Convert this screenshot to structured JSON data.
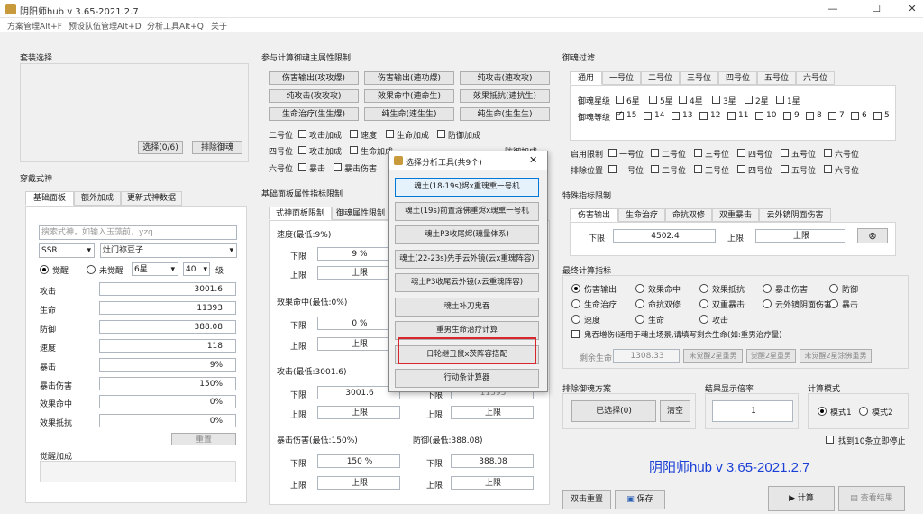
{
  "window": {
    "title": "阴阳师hub v 3.65-2021.2.7",
    "minimize": "—",
    "maximize": "☐",
    "close": "✕"
  },
  "menu": [
    "方案管理Alt+F",
    "预设队伍管理Alt+D",
    "分析工具Alt+Q",
    "关于"
  ],
  "set_select": {
    "title": "套装选择",
    "select_btn": "选择(0/6)",
    "exclude_btn": "排除御魂"
  },
  "equip": {
    "title": "穿戴式神",
    "tabs": [
      "基础面板",
      "额外加成",
      "更新式神数据"
    ],
    "search_placeholder": "搜索式神，如输入玉藻前，yzq…",
    "rarity": "SSR",
    "shikigami": "灶门祢豆子",
    "awake": "觉醒",
    "unawake": "未觉醒",
    "star": "6星",
    "level": "40",
    "level_unit": "级",
    "stats": [
      {
        "label": "攻击",
        "value": "3001.6"
      },
      {
        "label": "生命",
        "value": "11393"
      },
      {
        "label": "防御",
        "value": "388.08"
      },
      {
        "label": "速度",
        "value": "118"
      },
      {
        "label": "暴击",
        "value": "9%"
      },
      {
        "label": "暴击伤害",
        "value": "150%"
      },
      {
        "label": "效果命中",
        "value": "0%"
      },
      {
        "label": "效果抵抗",
        "value": "0%"
      }
    ],
    "reset": "重置",
    "awaken_bonus": "觉醒加成"
  },
  "attr_limit": {
    "title": "参与计算御魂主属性限制",
    "buttons": [
      [
        "伤害输出(攻攻爆)",
        "伤害输出(速功爆)",
        "纯攻击(速攻攻)"
      ],
      [
        "纯攻击(攻攻攻)",
        "效果命中(速命生)",
        "效果抵抗(速抗生)"
      ],
      [
        "生命治疗(生生爆)",
        "纯生命(速生生)",
        "纯生命(生生生)"
      ]
    ],
    "rows": [
      {
        "pos": "二号位",
        "opts": [
          "攻击加成",
          "速度",
          "生命加成",
          "防御加成"
        ]
      },
      {
        "pos": "四号位",
        "opts": [
          "攻击加成",
          "生命加成",
          "效果命中",
          "效果抵抗",
          "防御加成"
        ]
      },
      {
        "pos": "六号位",
        "opts": [
          "暴击",
          "暴击伤害"
        ]
      }
    ]
  },
  "base_limit": {
    "title": "基础面板属性指标限制",
    "tabs": [
      "式神面板限制",
      "御魂属性限制"
    ],
    "items": [
      {
        "title": "速度(最低:9%)",
        "min": "9 %",
        "max": "上限"
      },
      {
        "title": "效果命中(最低:0%)",
        "min": "0 %",
        "max": "上限"
      },
      {
        "title": "攻击(最低:3001.6)",
        "min": "3001.6",
        "max": "上限"
      },
      {
        "title": "暴击伤害(最低:150%)",
        "min": "150 %",
        "max": "上限"
      }
    ],
    "right_items": [
      {
        "title": "",
        "min": "11393",
        "max": "上限"
      },
      {
        "title": "防御(最低:388.08)",
        "min": "388.08",
        "max": "上限"
      }
    ],
    "min_label": "下限",
    "max_label": "上限"
  },
  "filter": {
    "title": "御魂过滤",
    "tabs": [
      "通用",
      "一号位",
      "二号位",
      "三号位",
      "四号位",
      "五号位",
      "六号位"
    ],
    "star_label": "御魂星级",
    "stars": [
      "6星",
      "5星",
      "4星",
      "3星",
      "2星",
      "1星"
    ],
    "level_label": "御魂等级",
    "levels": [
      "15",
      "14",
      "13",
      "12",
      "11",
      "10",
      "9",
      "8",
      "7",
      "6",
      "5"
    ],
    "enable_label": "启用限制",
    "exclude_label": "排除位置",
    "positions": [
      "一号位",
      "二号位",
      "三号位",
      "四号位",
      "五号位",
      "六号位"
    ]
  },
  "special": {
    "title": "特殊指标限制",
    "tabs": [
      "伤害输出",
      "生命治疗",
      "命抗双修",
      "双重暴击",
      "云外镜阴面伤害"
    ],
    "min_label": "下限",
    "min_value": "4502.4",
    "max_label": "上限",
    "max_value": "上限"
  },
  "final": {
    "title": "最终计算指标",
    "options": [
      [
        "伤害输出",
        "效果命中",
        "效果抵抗",
        "暴击伤害",
        "防御"
      ],
      [
        "生命治疗",
        "命抗双修",
        "双重暴击",
        "云外镜阴面伤害",
        "暴击"
      ],
      [
        "速度",
        "生命",
        "攻击"
      ]
    ],
    "note": "鬼吞增伤(适用于魂土场景,请填写剩余生命(如:重男治疗量)",
    "remain_label": "剩余生命",
    "remain_value": "1308.33",
    "b1": "未觉醒2星重男",
    "b2": "觉醒2星重男",
    "b3": "未觉醒2星涂佛重男"
  },
  "exclude_plan": {
    "title": "排除御魂方案",
    "selected": "已选择(0)",
    "clear": "清空"
  },
  "multiplier": {
    "title": "结果显示倍率",
    "value": "1"
  },
  "mode": {
    "title": "计算模式",
    "m1": "模式1",
    "m2": "模式2"
  },
  "stop10": "找到10条立即停止",
  "brand": "阴阳师hub v 3.65-2021.2.7",
  "bottom": {
    "dbl_reset": "双击重置",
    "save": "保存",
    "calc": "计算",
    "view": "查看结果"
  },
  "dialog": {
    "title": "选择分析工具(共9个)",
    "close": "✕",
    "items": [
      "魂土(18-19s)烬x重瑰熏一号机",
      "魂土(19s)前置涂佛重烬x瑰熏一号机",
      "魂土P3收尾烬(瑰量体系)",
      "魂土(22-23s)先手云外镜(云x重瑰阵容)",
      "魂土P3收尾云外镜(x云重瑰阵容)",
      "魂土补刀鬼吞",
      "重男生命治疗计算",
      "日轮继丑鼠x茨阵容搭配",
      "行动条计算器"
    ],
    "highlight_index": 7
  }
}
